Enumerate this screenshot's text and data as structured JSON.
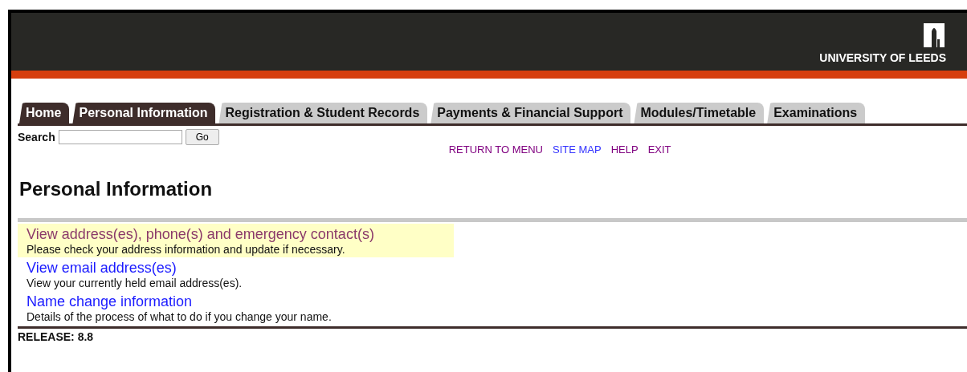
{
  "header": {
    "logo_text": "UNIVERSITY OF LEEDS"
  },
  "tabs": [
    {
      "label": "Home",
      "selected": true
    },
    {
      "label": "Personal Information",
      "selected": true
    },
    {
      "label": "Registration & Student Records",
      "selected": false
    },
    {
      "label": "Payments & Financial Support",
      "selected": false
    },
    {
      "label": "Modules/Timetable",
      "selected": false
    },
    {
      "label": "Examinations",
      "selected": false
    }
  ],
  "search": {
    "label": "Search",
    "button": "Go"
  },
  "nav_links": [
    {
      "label": "RETURN TO MENU",
      "visited": true
    },
    {
      "label": "SITE MAP",
      "visited": false
    },
    {
      "label": "HELP",
      "visited": true
    },
    {
      "label": "EXIT",
      "visited": true
    }
  ],
  "heading": "Personal Information",
  "menu_items": [
    {
      "link": "View address(es), phone(s) and emergency contact(s)",
      "description": "Please check your address information and update if necessary.",
      "highlighted": true,
      "visited": true
    },
    {
      "link": "View email address(es)",
      "description": "View your currently held email address(es).",
      "highlighted": false,
      "visited": false
    },
    {
      "link": "Name change information",
      "description": "Details of the process of what to do if you change your name.",
      "highlighted": false,
      "visited": false
    }
  ],
  "release": "RELEASE: 8.8"
}
